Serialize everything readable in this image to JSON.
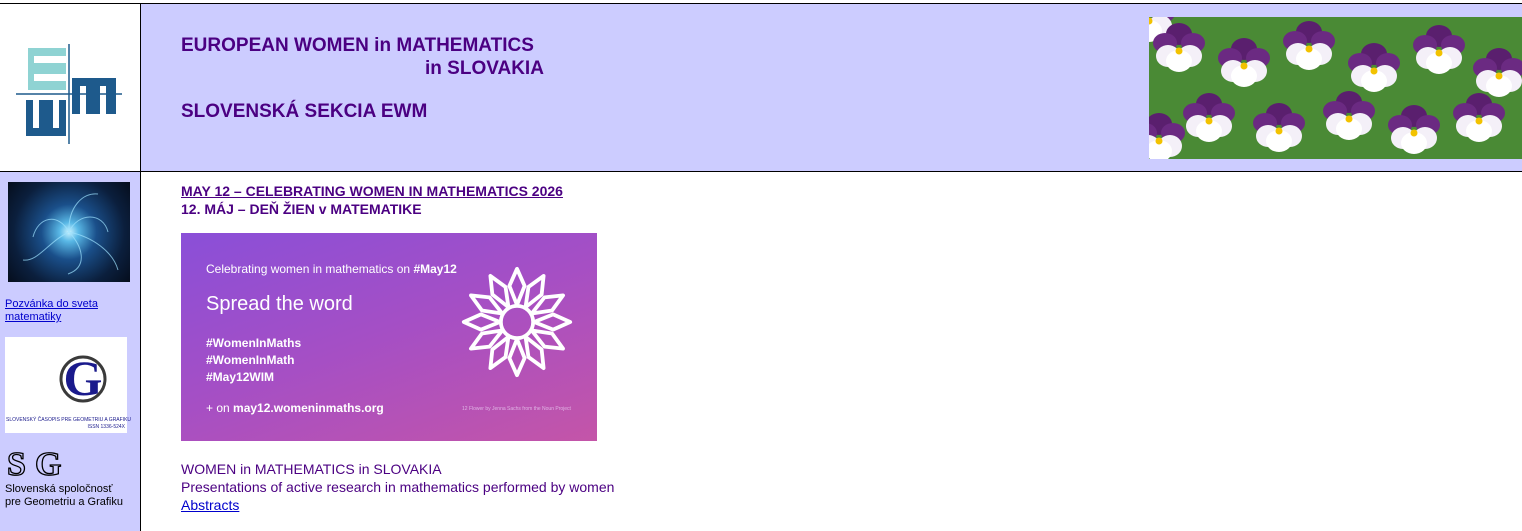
{
  "header": {
    "title_line1": "EUROPEAN WOMEN in MATHEMATICS",
    "title_line2": "in SLOVAKIA",
    "subtitle": "SLOVENSKÁ SEKCIA EWM",
    "logo_icon": "ewm-logo-icon",
    "photo_icon": "pansy-flowers-photo"
  },
  "sidebar": {
    "fractal_icon": "fractal-spiral-image",
    "invite_link": "Pozvánka do sveta matematiky",
    "journal_text": "SLOVENSKÝ ČASOPIS PRE GEOMETRIU A GRAFIKU",
    "journal_issn": "ISSN 1336-524X",
    "sgg_name_line1": "Slovenská spoločnosť",
    "sgg_name_line2": "pre Geometriu a Grafiku"
  },
  "main": {
    "news_link": "MAY 12 – CELEBRATING WOMEN IN MATHEMATICS 2026",
    "news_sub": "12. MÁJ – DEŇ ŽIEN v MATEMATIKE",
    "banner": {
      "line1_prefix": "Celebrating women in mathematics on ",
      "line1_tag": "#May12",
      "spread": "Spread the word",
      "tags": [
        "#WomenInMaths",
        "#WomenInMath",
        "#May12WIM"
      ],
      "site_prefix": "+ on ",
      "site": "may12.womeninmaths.org",
      "credit": "12 Flower by Jenna Sachs from the Noun Project"
    },
    "section_title": "WOMEN in MATHEMATICS in SLOVAKIA",
    "section_desc": "Presentations of active research in mathematics performed by women",
    "abstracts_link": "Abstracts"
  },
  "colors": {
    "header_bg": "#ccccff",
    "title": "#4b0082",
    "link": "#0000cc"
  }
}
